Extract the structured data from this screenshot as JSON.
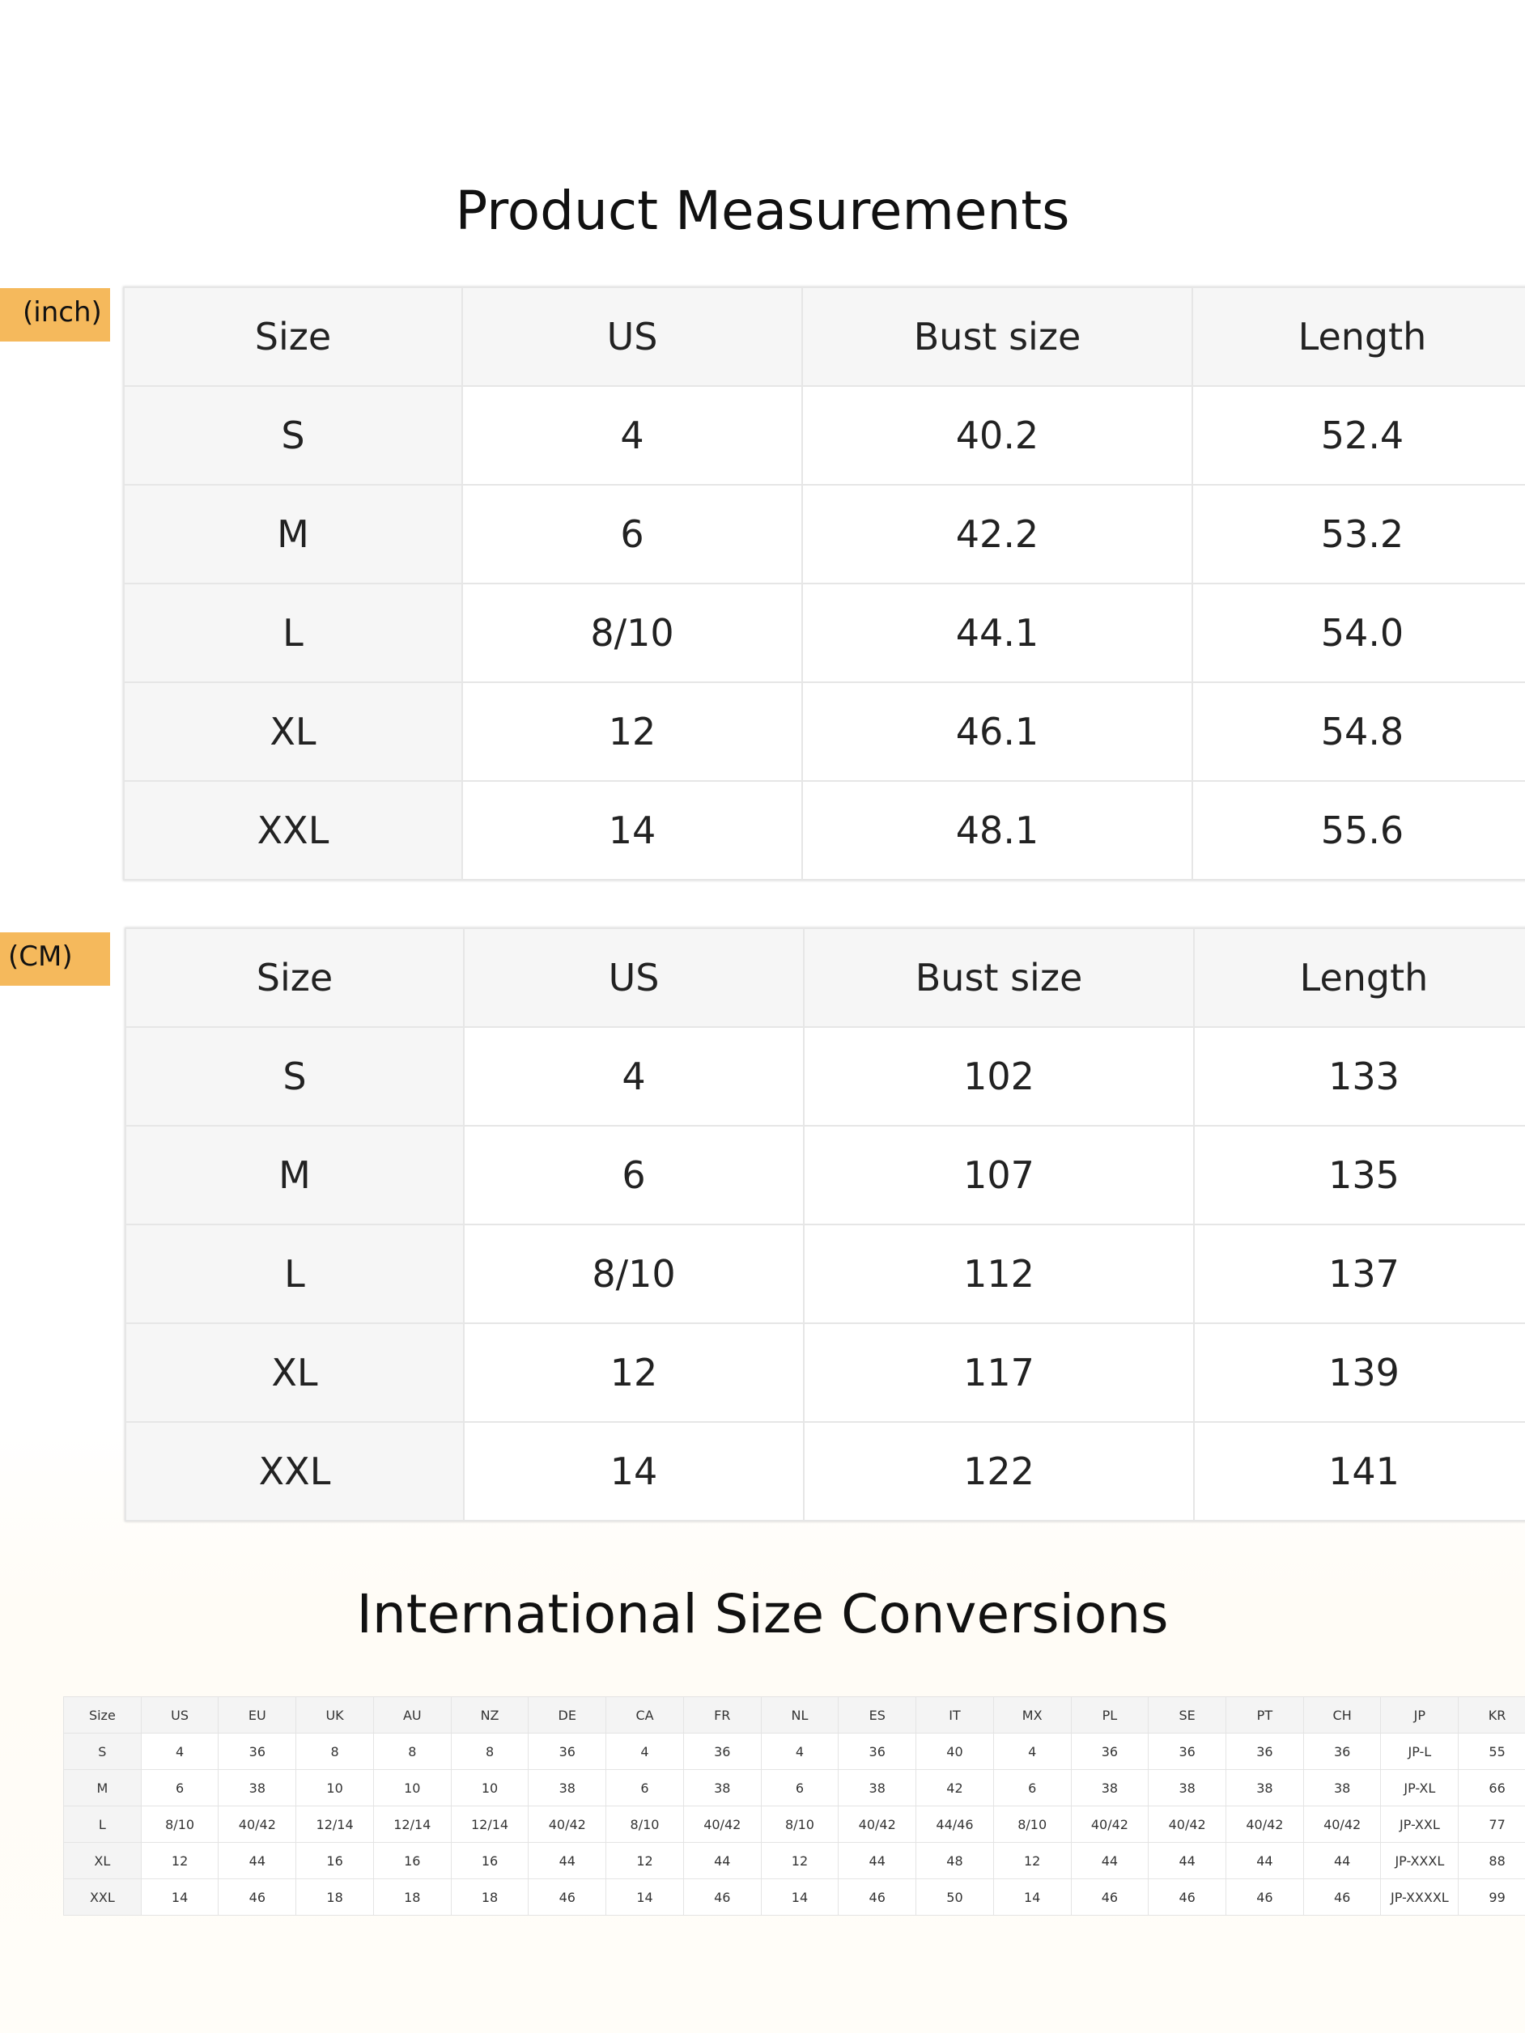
{
  "titles": {
    "product_measurements": "Product Measurements",
    "international_conversions": "International Size Conversions"
  },
  "inch_table": {
    "unit_label": "(inch)",
    "headers": [
      "Size",
      "US",
      "Bust size",
      "Length"
    ],
    "rows": [
      [
        "S",
        "4",
        "40.2",
        "52.4"
      ],
      [
        "M",
        "6",
        "42.2",
        "53.2"
      ],
      [
        "L",
        "8/10",
        "44.1",
        "54.0"
      ],
      [
        "XL",
        "12",
        "46.1",
        "54.8"
      ],
      [
        "XXL",
        "14",
        "48.1",
        "55.6"
      ]
    ]
  },
  "cm_table": {
    "unit_label": "(CM)",
    "headers": [
      "Size",
      "US",
      "Bust size",
      "Length"
    ],
    "rows": [
      [
        "S",
        "4",
        "102",
        "133"
      ],
      [
        "M",
        "6",
        "107",
        "135"
      ],
      [
        "L",
        "8/10",
        "112",
        "137"
      ],
      [
        "XL",
        "12",
        "117",
        "139"
      ],
      [
        "XXL",
        "14",
        "122",
        "141"
      ]
    ]
  },
  "intl_table": {
    "headers": [
      "Size",
      "US",
      "EU",
      "UK",
      "AU",
      "NZ",
      "DE",
      "CA",
      "FR",
      "NL",
      "ES",
      "IT",
      "MX",
      "PL",
      "SE",
      "PT",
      "CH",
      "JP",
      "KR"
    ],
    "rows": [
      [
        "S",
        "4",
        "36",
        "8",
        "8",
        "8",
        "36",
        "4",
        "36",
        "4",
        "36",
        "40",
        "4",
        "36",
        "36",
        "36",
        "36",
        "JP-L",
        "55"
      ],
      [
        "M",
        "6",
        "38",
        "10",
        "10",
        "10",
        "38",
        "6",
        "38",
        "6",
        "38",
        "42",
        "6",
        "38",
        "38",
        "38",
        "38",
        "JP-XL",
        "66"
      ],
      [
        "L",
        "8/10",
        "40/42",
        "12/14",
        "12/14",
        "12/14",
        "40/42",
        "8/10",
        "40/42",
        "8/10",
        "40/42",
        "44/46",
        "8/10",
        "40/42",
        "40/42",
        "40/42",
        "40/42",
        "JP-XXL",
        "77"
      ],
      [
        "XL",
        "12",
        "44",
        "16",
        "16",
        "16",
        "44",
        "12",
        "44",
        "12",
        "44",
        "48",
        "12",
        "44",
        "44",
        "44",
        "44",
        "JP-XXXL",
        "88"
      ],
      [
        "XXL",
        "14",
        "46",
        "18",
        "18",
        "18",
        "46",
        "14",
        "46",
        "14",
        "46",
        "50",
        "14",
        "46",
        "46",
        "46",
        "46",
        "JP-XXXXL",
        "99"
      ]
    ]
  }
}
